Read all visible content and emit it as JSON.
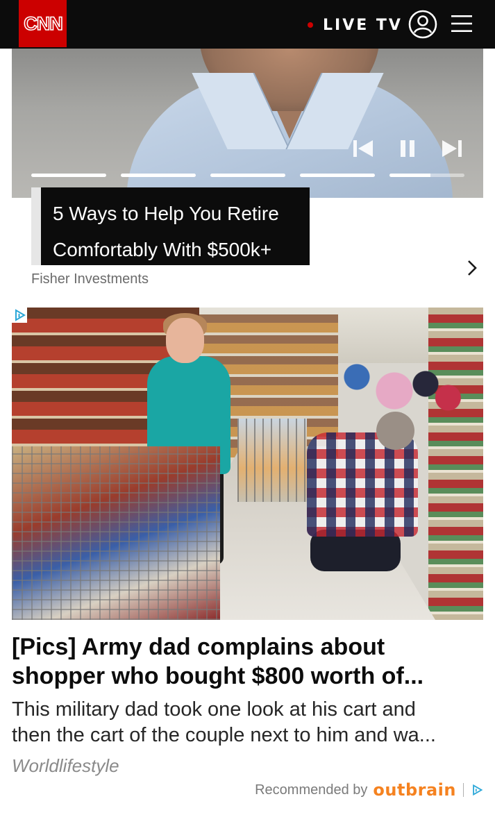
{
  "header": {
    "logo_text": "CNN",
    "live_label": "LIVE TV",
    "account_icon": "account-icon",
    "menu_icon": "hamburger-menu-icon",
    "colors": {
      "brand": "#cc0000",
      "bar": "#0c0c0c"
    }
  },
  "video_ad": {
    "title_line1": "5 Ways to Help You Retire",
    "title_line2": "Comfortably With $500k+",
    "sponsor": "Fisher Investments",
    "controls": [
      "previous-icon",
      "pause-icon",
      "next-icon"
    ],
    "progress_segments": [
      1,
      1,
      1,
      1,
      0.55
    ]
  },
  "outbrain_ad": {
    "headline_line1": "[Pics] Army dad complains about",
    "headline_line2": "shopper who bought $800 worth of...",
    "description_line1": "This military dad took one look at his cart and",
    "description_line2": "then the cart of the couple next to him and wa...",
    "source": "Worldlifestyle",
    "recommended_label": "Recommended by",
    "brand": "outbrain",
    "brand_color": "#f58220"
  }
}
